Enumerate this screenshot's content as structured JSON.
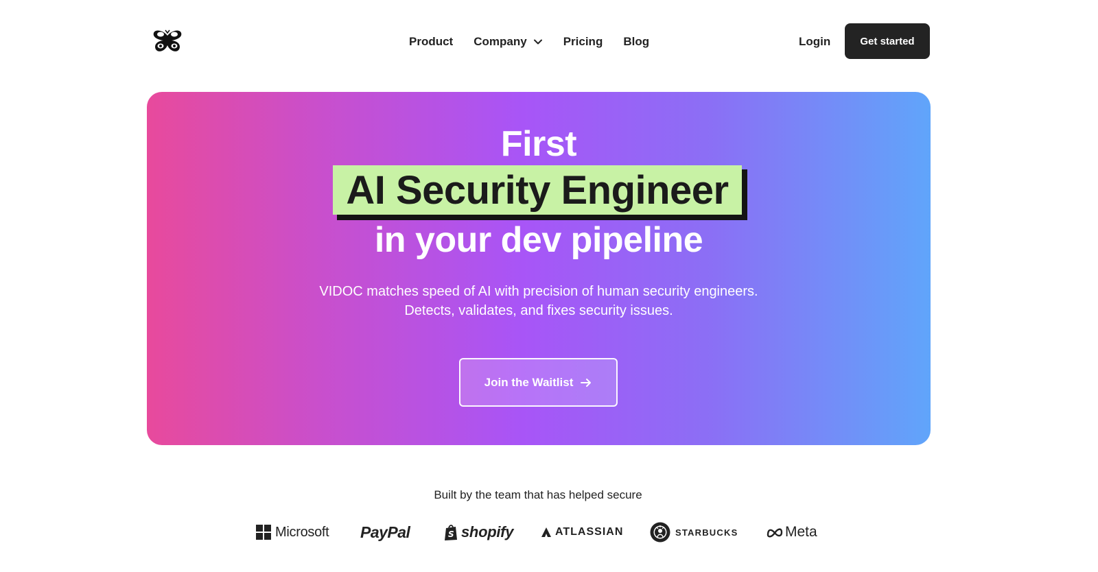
{
  "header": {
    "logo_name": "butterfly-logo",
    "nav": [
      {
        "label": "Product",
        "has_dropdown": false
      },
      {
        "label": "Company",
        "has_dropdown": true
      },
      {
        "label": "Pricing",
        "has_dropdown": false
      },
      {
        "label": "Blog",
        "has_dropdown": false
      }
    ],
    "login_label": "Login",
    "cta_label": "Get started"
  },
  "hero": {
    "line1": "First",
    "highlight": "AI Security Engineer",
    "line3": "in your dev pipeline",
    "subtitle_lines": [
      "VIDOC matches speed of AI with precision of human security engineers.",
      "Detects, validates, and fixes security issues."
    ],
    "cta_label": "Join the Waitlist",
    "gradient_colors": [
      "#e84a9c",
      "#a855f7",
      "#60a5fa"
    ],
    "highlight_color": "#c8f2a5"
  },
  "trusted": {
    "title": "Built by the team that has helped secure",
    "brands": [
      "Microsoft",
      "PayPal",
      "shopify",
      "ATLASSIAN",
      "STARBUCKS",
      "Meta"
    ]
  }
}
